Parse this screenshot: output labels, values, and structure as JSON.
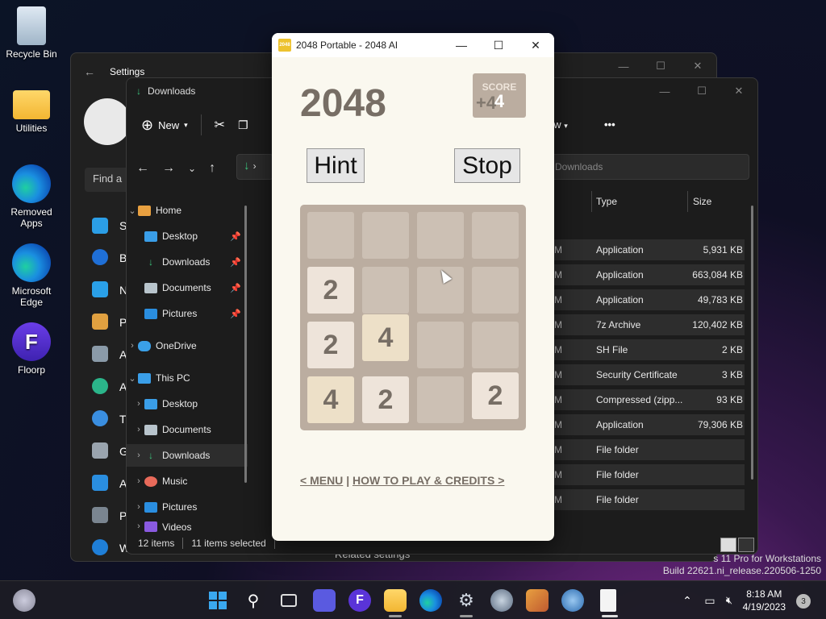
{
  "desktop": {
    "icons": [
      {
        "label": "Recycle Bin"
      },
      {
        "label": "Utilities"
      },
      {
        "label": "Removed Apps"
      },
      {
        "label": "Microsoft Edge"
      },
      {
        "label": "Floorp"
      }
    ]
  },
  "settings": {
    "title": "Settings",
    "search_placeholder": "Find a",
    "nav_letters": [
      "S",
      "B",
      "N",
      "P",
      "A",
      "A",
      "T",
      "G",
      "A",
      "P",
      "W"
    ],
    "related_settings": "Related settings"
  },
  "explorer": {
    "title": "Downloads",
    "toolbar": {
      "new_label": "New",
      "view_label": "ew",
      "more_label": "•••"
    },
    "search_placeholder": "Downloads",
    "nav": [
      {
        "label": "Home"
      },
      {
        "label": "Desktop"
      },
      {
        "label": "Downloads"
      },
      {
        "label": "Documents"
      },
      {
        "label": "Pictures"
      },
      {
        "label": "OneDrive"
      },
      {
        "label": "This PC"
      },
      {
        "label": "Desktop"
      },
      {
        "label": "Documents"
      },
      {
        "label": "Downloads"
      },
      {
        "label": "Music"
      },
      {
        "label": "Pictures"
      },
      {
        "label": "Videos"
      }
    ],
    "columns": {
      "type": "Type",
      "size": "Size"
    },
    "rows": [
      {
        "m": "M",
        "type": "Application",
        "size": "5,931 KB"
      },
      {
        "m": "M",
        "type": "Application",
        "size": "663,084 KB"
      },
      {
        "m": "M",
        "type": "Application",
        "size": "49,783 KB"
      },
      {
        "m": "M",
        "type": "7z Archive",
        "size": "120,402 KB"
      },
      {
        "m": "M",
        "type": "SH File",
        "size": "2 KB"
      },
      {
        "m": "M",
        "type": "Security Certificate",
        "size": "3 KB"
      },
      {
        "m": "M",
        "type": "Compressed (zipp...",
        "size": "93 KB"
      },
      {
        "m": "M",
        "type": "Application",
        "size": "79,306 KB"
      },
      {
        "m": "M",
        "type": "File folder",
        "size": ""
      },
      {
        "m": "M",
        "type": "File folder",
        "size": ""
      },
      {
        "m": "M",
        "type": "File folder",
        "size": ""
      }
    ],
    "status": {
      "items": "12 items",
      "selected": "11 items selected"
    }
  },
  "game": {
    "window_title": "2048 Portable - 2048 AI",
    "app_icon_text": "2048",
    "title": "2048",
    "score_label": "SCORE",
    "score_value": "4",
    "score_add": "+4",
    "hint_label": "Hint",
    "stop_label": "Stop",
    "board": [
      [
        "",
        "",
        "",
        ""
      ],
      [
        "2",
        "",
        "",
        ""
      ],
      [
        "2",
        "4",
        "",
        ""
      ],
      [
        "4",
        "2",
        "",
        "2"
      ]
    ],
    "menu_link": "< MENU",
    "link_sep": "|",
    "howto_link": "HOW TO PLAY & CREDITS >"
  },
  "watermark": {
    "line1": "s 11 Pro for Workstations",
    "line2": "Build 22621.ni_release.220506-1250"
  },
  "taskbar": {
    "time": "8:18 AM",
    "date": "4/19/2023",
    "notifications": "3"
  }
}
